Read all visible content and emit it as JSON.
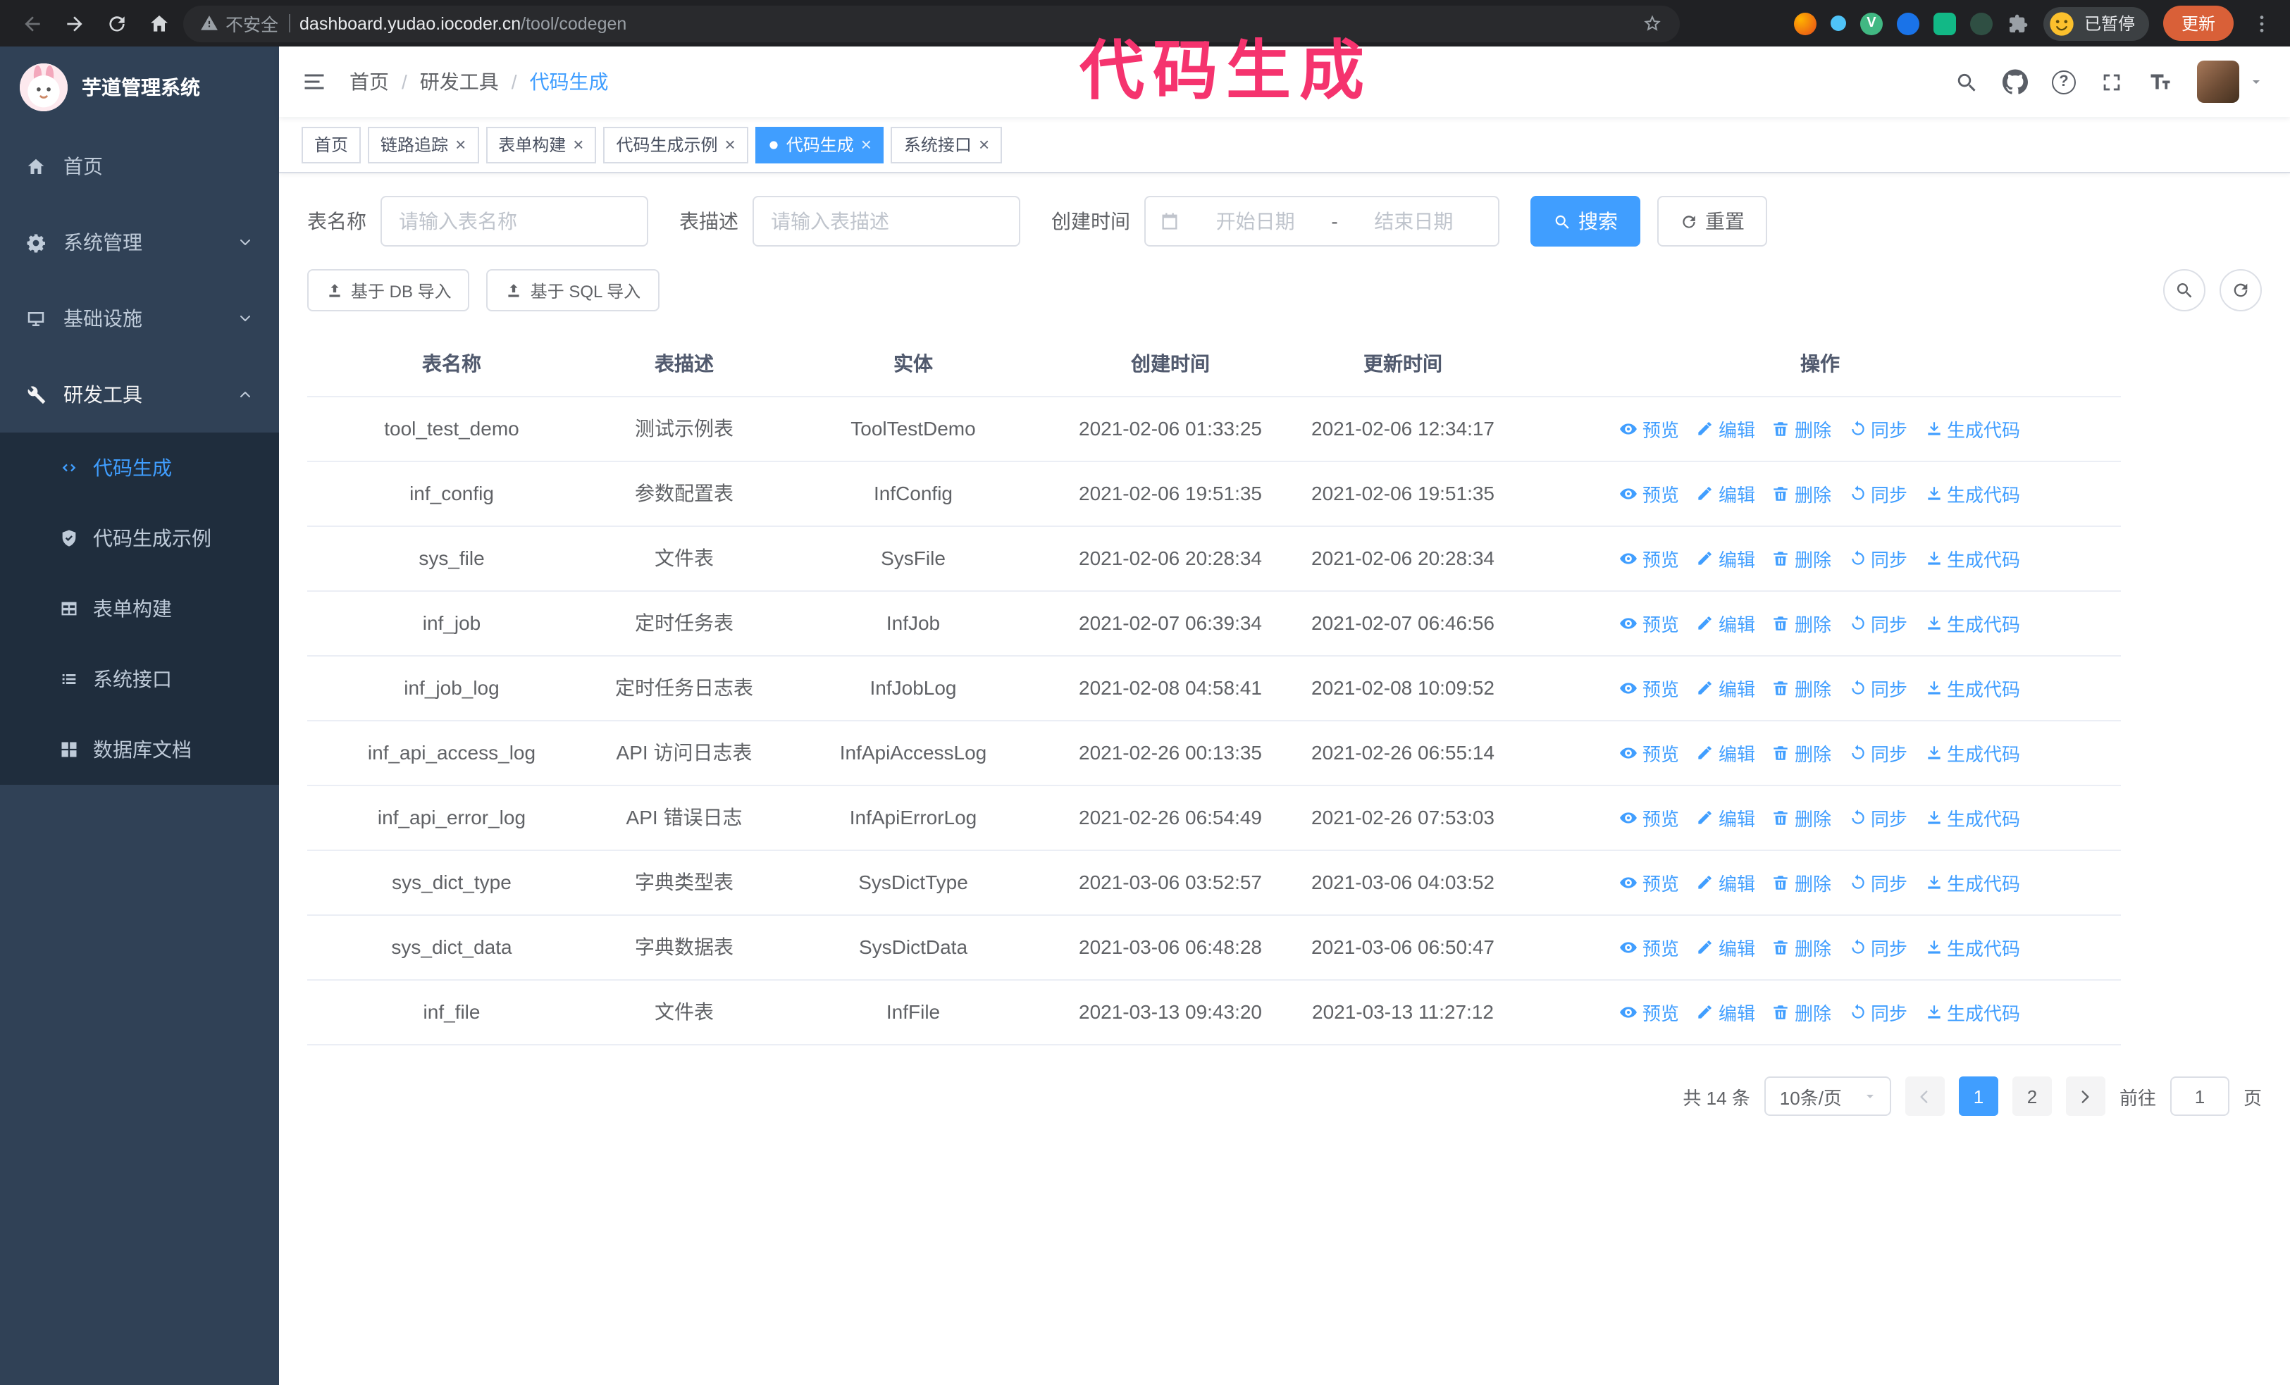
{
  "colors": {
    "primary": "#409eff",
    "sidebar_bg": "#304156",
    "submenu_bg": "#1f2d3d",
    "annotation": "#f5336e",
    "update_pill": "#d96038"
  },
  "annotation": {
    "text": "代码生成"
  },
  "browser": {
    "security_label": "不安全",
    "url_domain": "dashboard.yudao.iocoder.cn",
    "url_path": "/tool/codegen",
    "paused_badge": "已暂停",
    "update_button": "更新"
  },
  "sidebar": {
    "logo_title": "芋道管理系统",
    "menu": [
      {
        "label": "首页"
      },
      {
        "label": "系统管理"
      },
      {
        "label": "基础设施"
      },
      {
        "label": "研发工具"
      }
    ],
    "submenu": [
      {
        "label": "代码生成"
      },
      {
        "label": "代码生成示例"
      },
      {
        "label": "表单构建"
      },
      {
        "label": "系统接口"
      },
      {
        "label": "数据库文档"
      }
    ]
  },
  "header": {
    "breadcrumb": [
      "首页",
      "研发工具",
      "代码生成"
    ],
    "separator": "/"
  },
  "tabs": [
    {
      "label": "首页"
    },
    {
      "label": "链路追踪"
    },
    {
      "label": "表单构建"
    },
    {
      "label": "代码生成示例"
    },
    {
      "label": "代码生成"
    },
    {
      "label": "系统接口"
    }
  ],
  "filters": {
    "table_name_label": "表名称",
    "table_name_placeholder": "请输入表名称",
    "table_desc_label": "表描述",
    "table_desc_placeholder": "请输入表描述",
    "create_time_label": "创建时间",
    "date_start_placeholder": "开始日期",
    "date_separator": "-",
    "date_end_placeholder": "结束日期",
    "search_button": "搜索",
    "reset_button": "重置"
  },
  "toolbar": {
    "import_db_button": "基于 DB 导入",
    "import_sql_button": "基于 SQL 导入"
  },
  "table": {
    "columns": [
      "表名称",
      "表描述",
      "实体",
      "创建时间",
      "更新时间",
      "操作"
    ],
    "actions": [
      "预览",
      "编辑",
      "删除",
      "同步",
      "生成代码"
    ],
    "rows": [
      {
        "name": "tool_test_demo",
        "desc": "测试示例表",
        "entity": "ToolTestDemo",
        "created": "2021-02-06 01:33:25",
        "updated": "2021-02-06 12:34:17"
      },
      {
        "name": "inf_config",
        "desc": "参数配置表",
        "entity": "InfConfig",
        "created": "2021-02-06 19:51:35",
        "updated": "2021-02-06 19:51:35"
      },
      {
        "name": "sys_file",
        "desc": "文件表",
        "entity": "SysFile",
        "created": "2021-02-06 20:28:34",
        "updated": "2021-02-06 20:28:34"
      },
      {
        "name": "inf_job",
        "desc": "定时任务表",
        "entity": "InfJob",
        "created": "2021-02-07 06:39:34",
        "updated": "2021-02-07 06:46:56"
      },
      {
        "name": "inf_job_log",
        "desc": "定时任务日志表",
        "entity": "InfJobLog",
        "created": "2021-02-08 04:58:41",
        "updated": "2021-02-08 10:09:52"
      },
      {
        "name": "inf_api_access_log",
        "desc": "API 访问日志表",
        "entity": "InfApiAccessLog",
        "created": "2021-02-26 00:13:35",
        "updated": "2021-02-26 06:55:14"
      },
      {
        "name": "inf_api_error_log",
        "desc": "API 错误日志",
        "entity": "InfApiErrorLog",
        "created": "2021-02-26 06:54:49",
        "updated": "2021-02-26 07:53:03"
      },
      {
        "name": "sys_dict_type",
        "desc": "字典类型表",
        "entity": "SysDictType",
        "created": "2021-03-06 03:52:57",
        "updated": "2021-03-06 04:03:52"
      },
      {
        "name": "sys_dict_data",
        "desc": "字典数据表",
        "entity": "SysDictData",
        "created": "2021-03-06 06:48:28",
        "updated": "2021-03-06 06:50:47"
      },
      {
        "name": "inf_file",
        "desc": "文件表",
        "entity": "InfFile",
        "created": "2021-03-13 09:43:20",
        "updated": "2021-03-13 11:27:12"
      }
    ]
  },
  "pagination": {
    "total_text": "共 14 条",
    "page_size": "10条/页",
    "pages": [
      "1",
      "2"
    ],
    "goto_label": "前往",
    "goto_value": "1",
    "goto_suffix": "页"
  }
}
